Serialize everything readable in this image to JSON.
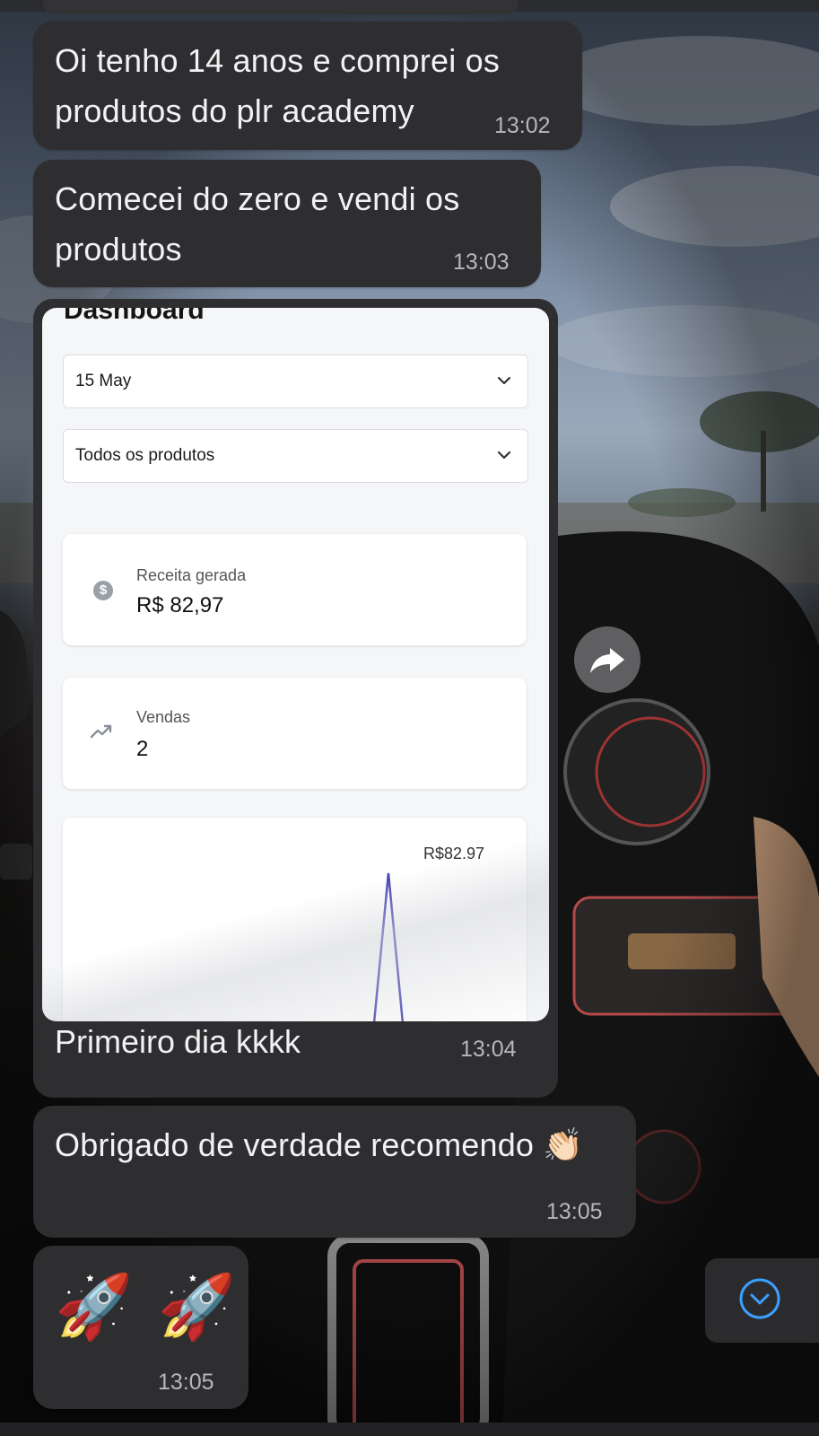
{
  "messages": [
    {
      "text": "Oi tenho 14 anos e comprei os produtos do plr academy",
      "time": "13:02"
    },
    {
      "text": "Comecei do zero e vendi os produtos",
      "time": "13:03"
    },
    {
      "caption": "Primeiro dia kkkk",
      "time": "13:04"
    },
    {
      "text": "Obrigado de verdade recomendo 👏🏻",
      "time": "13:05"
    },
    {
      "text": "🚀 🚀",
      "time": "13:05"
    }
  ],
  "dashboard": {
    "title": "Dashboard",
    "date_select": "15 May",
    "product_select": "Todos os produtos",
    "revenue_label": "Receita gerada",
    "revenue_value": "R$ 82,97",
    "sales_label": "Vendas",
    "sales_value": "2",
    "peak_label": "R$82.97"
  },
  "chart_data": {
    "type": "line",
    "title": "",
    "series": [
      {
        "values": [
          0,
          82.97,
          0
        ]
      }
    ],
    "annotations": [
      "R$82.97"
    ]
  },
  "icons": {
    "share": "share-arrow-icon",
    "scroll": "chevron-down-circle-icon",
    "dropdown": "chevron-down-icon",
    "revenue": "dollar-icon",
    "sales": "trend-up-icon"
  },
  "colors": {
    "bubble": "#2e2e30",
    "chart_line": "#4a47b5",
    "accent_blue": "#3aa0ff"
  }
}
